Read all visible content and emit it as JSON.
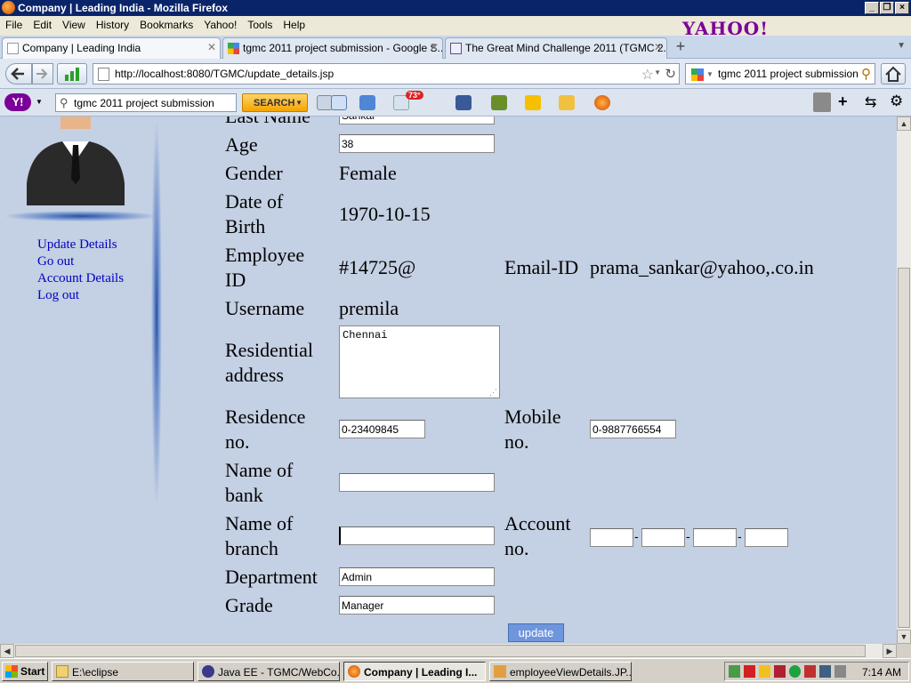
{
  "window": {
    "title": "Company | Leading India - Mozilla Firefox"
  },
  "menu": [
    "File",
    "Edit",
    "View",
    "History",
    "Bookmarks",
    "Yahoo!",
    "Tools",
    "Help"
  ],
  "brand_logo": "YAHOO!",
  "tabs": [
    {
      "label": "Company | Leading India",
      "active": true
    },
    {
      "label": "tgmc 2011 project submission - Google S...",
      "active": false
    },
    {
      "label": "The Great Mind Challenge 2011 (TGMC 2...",
      "active": false
    }
  ],
  "nav": {
    "url": "http://localhost:8080/TGMC/update_details.jsp",
    "search_value": "tgmc 2011 project submission"
  },
  "yahoo_toolbar": {
    "search_value": "tgmc 2011 project submission",
    "search_button": "SEARCH",
    "weather_badge": "73°"
  },
  "sidebar": {
    "links": [
      "Update Details",
      "Go out",
      "Account Details",
      "Log out"
    ]
  },
  "form": {
    "last_name_label": "Last Name",
    "last_name_value": "Sankar",
    "age_label": "Age",
    "age_value": "38",
    "gender_label": "Gender",
    "gender_value": "Female",
    "dob_label_1": "Date of",
    "dob_label_2": "Birth",
    "dob_value": "1970-10-15",
    "empid_label_1": "Employee",
    "empid_label_2": "ID",
    "empid_value": "#14725@",
    "email_label": "Email-ID",
    "email_value": "prama_sankar@yahoo,.co.in",
    "username_label": "Username",
    "username_value": "premila",
    "address_label_1": "Residential",
    "address_label_2": "address",
    "address_value": "Chennai",
    "residence_label_1": "Residence",
    "residence_label_2": "no.",
    "residence_value": "0-23409845",
    "mobile_label_1": "Mobile",
    "mobile_label_2": "no.",
    "mobile_value": "0-9887766554",
    "bank_label_1": "Name of",
    "bank_label_2": "bank",
    "bank_value": "",
    "branch_label_1": "Name of",
    "branch_label_2": "branch",
    "branch_value": "",
    "account_label_1": "Account",
    "account_label_2": "no.",
    "account_parts": [
      "",
      "",
      "",
      ""
    ],
    "account_separator": "-",
    "department_label": "Department",
    "department_value": "Admin",
    "grade_label": "Grade",
    "grade_value": "Manager",
    "update_button": "update"
  },
  "taskbar": {
    "start": "Start",
    "tasks": [
      {
        "label": "E:\\eclipse",
        "active": false
      },
      {
        "label": "Java EE - TGMC/WebCo...",
        "active": false
      },
      {
        "label": "Company | Leading I...",
        "active": true
      },
      {
        "label": "employeeViewDetails.JP...",
        "active": false
      }
    ],
    "clock": "7:14 AM"
  }
}
